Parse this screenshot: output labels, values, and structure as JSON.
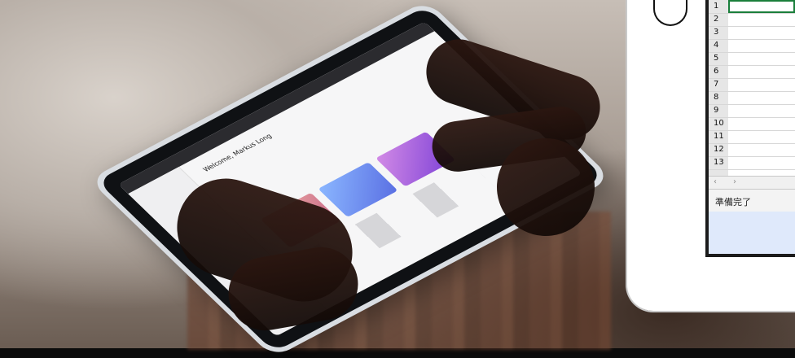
{
  "tablet": {
    "welcome_text": "Welcome, Markus Long"
  },
  "spreadsheet": {
    "row_numbers": [
      "1",
      "2",
      "3",
      "4",
      "5",
      "6",
      "7",
      "8",
      "9",
      "10",
      "11",
      "12",
      "13"
    ],
    "status_text": "準備完了"
  }
}
